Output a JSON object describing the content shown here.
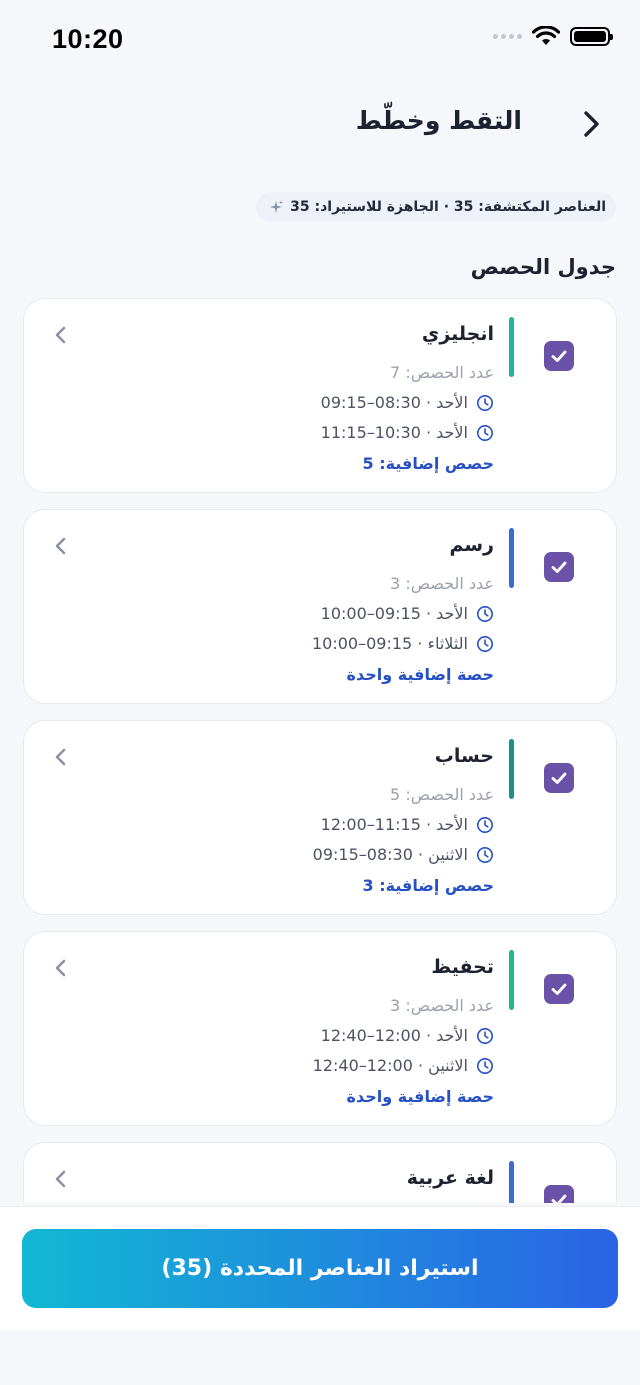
{
  "status_bar": {
    "time": "10:20"
  },
  "header": {
    "title": "التقط وخطّط"
  },
  "stats": {
    "text": "العناصر المكتشفة: 35 · الجاهزة للاستيراد: 35"
  },
  "section": {
    "title": "جدول الحصص"
  },
  "colors": {
    "accent_purple": "#6a52a8",
    "link_blue": "#2750c5",
    "gradient_start": "#12b8d4",
    "gradient_end": "#2a63e6"
  },
  "icons": {
    "back": "chevron-right-icon",
    "expand": "chevron-left-icon",
    "clock": "clock-icon",
    "check": "checkmark-icon",
    "sparkle": "sparkle-icon"
  },
  "subjects": [
    {
      "title": "انجليزي",
      "count": "عدد الحصص: 7",
      "slot1": "الأحد · 08:30–09:15",
      "slot2": "الأحد · 10:30–11:15",
      "extra": "حصص إضافية: 5",
      "bar_color": "#1fb89a",
      "checked": true
    },
    {
      "title": "رسم",
      "count": "عدد الحصص: 3",
      "slot1": "الأحد · 09:15–10:00",
      "slot2": "الثلاثاء · 09:15–10:00",
      "extra": "حصة إضافية واحدة",
      "bar_color": "#3a6ad8",
      "checked": true
    },
    {
      "title": "حساب",
      "count": "عدد الحصص: 5",
      "slot1": "الأحد · 11:15–12:00",
      "slot2": "الاثنين · 08:30–09:15",
      "extra": "حصص إضافية: 3",
      "bar_color": "#16928a",
      "checked": true
    },
    {
      "title": "تحفيظ",
      "count": "عدد الحصص: 3",
      "slot1": "الأحد · 12:00–12:40",
      "slot2": "الاثنين · 12:00–12:40",
      "extra": "حصة إضافية واحدة",
      "bar_color": "#22b888",
      "checked": true
    },
    {
      "title": "لغة عربية",
      "bar_color": "#3a6ad8",
      "checked": true
    }
  ],
  "footer": {
    "import_label": "استيراد العناصر المحددة (35)"
  }
}
